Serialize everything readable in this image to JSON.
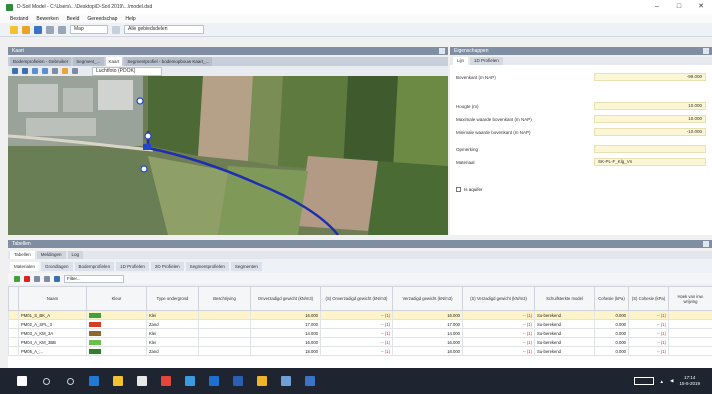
{
  "window": {
    "title": "D-Soil Model - C:\\Users\\...\\Desktop\\D-Soil 2019\\...\\model.dsd",
    "controls": [
      "–",
      "□",
      "✕"
    ]
  },
  "menu": [
    "Bestand",
    "Bewerken",
    "Beeld",
    "Gereedschap",
    "Help"
  ],
  "toolbar": {
    "select1": "Map",
    "select2": "Alle gebiedsdelen"
  },
  "map_panel": {
    "header": "Kaart",
    "tabs": [
      "Bodemprofielen - Gebruiker",
      "Segment_...",
      "Kaart",
      "Segmentprofiel - bodemopbouw Kaart_..."
    ],
    "active_tab": 2,
    "layer_select": "Luchtfoto (PDOK)"
  },
  "props_panel": {
    "header": "Eigenschappen",
    "tabs": [
      "Lijn",
      "1D Profielen"
    ],
    "rows": [
      {
        "label": "Bovenkant (m NAP)",
        "value": "-99.000"
      },
      {
        "label": "Hoogte (m)",
        "value": "10.000"
      },
      {
        "label": "Maximale waarde bovenkant (m NAP)",
        "value": "10.000"
      },
      {
        "label": "Minimale waarde bovenkant (m NAP)",
        "value": "-10.000"
      },
      {
        "label": "Opmerking",
        "value": ""
      },
      {
        "label": "Materiaal",
        "value": "SK-PL-F_Klg_Vn"
      }
    ],
    "check_label": "Is aquifer"
  },
  "bottom_panel": {
    "header": "Tabellen",
    "tabs": [
      "Tabellen",
      "Meldingen",
      "Log"
    ],
    "sub_tabs": [
      "Materialen",
      "Grondlagen",
      "Bodemprofielen",
      "1D Profielen",
      "2D Profielen",
      "Segmentprofielen",
      "Segmenten"
    ],
    "filter": "Filter...",
    "columns": [
      "Naam",
      "Kleur",
      "Type ondergrond",
      "Beschrijving",
      "Onverzadigd gewicht (kN/m3)",
      "(S) Onverzadigd gewicht (kN/m3)",
      "Verzadigd gewicht (kN/m3)",
      "(S) Verzadigd gewicht (kN/m3)",
      "Schuifsterkte model",
      "Cohesie (kPa)",
      "(S) Cohesie (kPa)",
      "Hoek van inw. wrijving"
    ],
    "rows": [
      {
        "name": "PM01_S_BK_A",
        "color": "#3fa33a",
        "type": "Klei",
        "desc": "",
        "g_unsat": "16.000",
        "s_unsat": "-- (1)",
        "g_sat": "16.000",
        "s_sat": "-- (1)",
        "model": "Su-berekend",
        "coh": "0.000",
        "s_coh": "-- (1)",
        "phi": "",
        "selected": true
      },
      {
        "name": "PM02_A_SPL_3",
        "color": "#d63b2a",
        "type": "Zand",
        "desc": "",
        "g_unsat": "17.000",
        "s_unsat": "-- (1)",
        "g_sat": "17.000",
        "s_sat": "-- (1)",
        "model": "Su-berekend",
        "coh": "0.000",
        "s_coh": "-- (1)",
        "phi": "",
        "selected": false
      },
      {
        "name": "PM03_A_KM_3A",
        "color": "#8c6a2a",
        "type": "Klei",
        "desc": "",
        "g_unsat": "14.000",
        "s_unsat": "-- (1)",
        "g_sat": "14.000",
        "s_sat": "-- (1)",
        "model": "Su-berekend",
        "coh": "0.000",
        "s_coh": "-- (1)",
        "phi": "",
        "selected": false
      },
      {
        "name": "PM04_A_KM_3BB",
        "color": "#6cbf4a",
        "type": "Klei",
        "desc": "",
        "g_unsat": "16.000",
        "s_unsat": "-- (1)",
        "g_sat": "16.000",
        "s_sat": "-- (1)",
        "model": "Su-berekend",
        "coh": "0.000",
        "s_coh": "-- (1)",
        "phi": "",
        "selected": false
      },
      {
        "name": "PM05_A_...",
        "color": "#2f7d2f",
        "type": "Zand",
        "desc": "",
        "g_unsat": "18.000",
        "s_unsat": "-- (1)",
        "g_sat": "18.000",
        "s_sat": "-- (1)",
        "model": "Su-berekend",
        "coh": "0.000",
        "s_coh": "-- (1)",
        "phi": "",
        "selected": false
      }
    ]
  },
  "taskbar": {
    "time": "17:14",
    "date": "15-5-2019",
    "icons": [
      {
        "name": "start",
        "color": "#ffffff"
      },
      {
        "name": "search",
        "color": "#c9d1dc"
      },
      {
        "name": "task-view",
        "color": "#c9d1dc"
      },
      {
        "name": "edge",
        "color": "#1f7ad6"
      },
      {
        "name": "explorer",
        "color": "#f2c230"
      },
      {
        "name": "store",
        "color": "#e8e8e8"
      },
      {
        "name": "chrome",
        "color": "#e4463b"
      },
      {
        "name": "app-blue",
        "color": "#3a9be0"
      },
      {
        "name": "outlook",
        "color": "#1d6fd1"
      },
      {
        "name": "word",
        "color": "#2b5eb5"
      },
      {
        "name": "files",
        "color": "#f0b429"
      },
      {
        "name": "dsoil",
        "color": "#6fa0d8"
      },
      {
        "name": "app-dark",
        "color": "#3b74c7"
      }
    ]
  }
}
